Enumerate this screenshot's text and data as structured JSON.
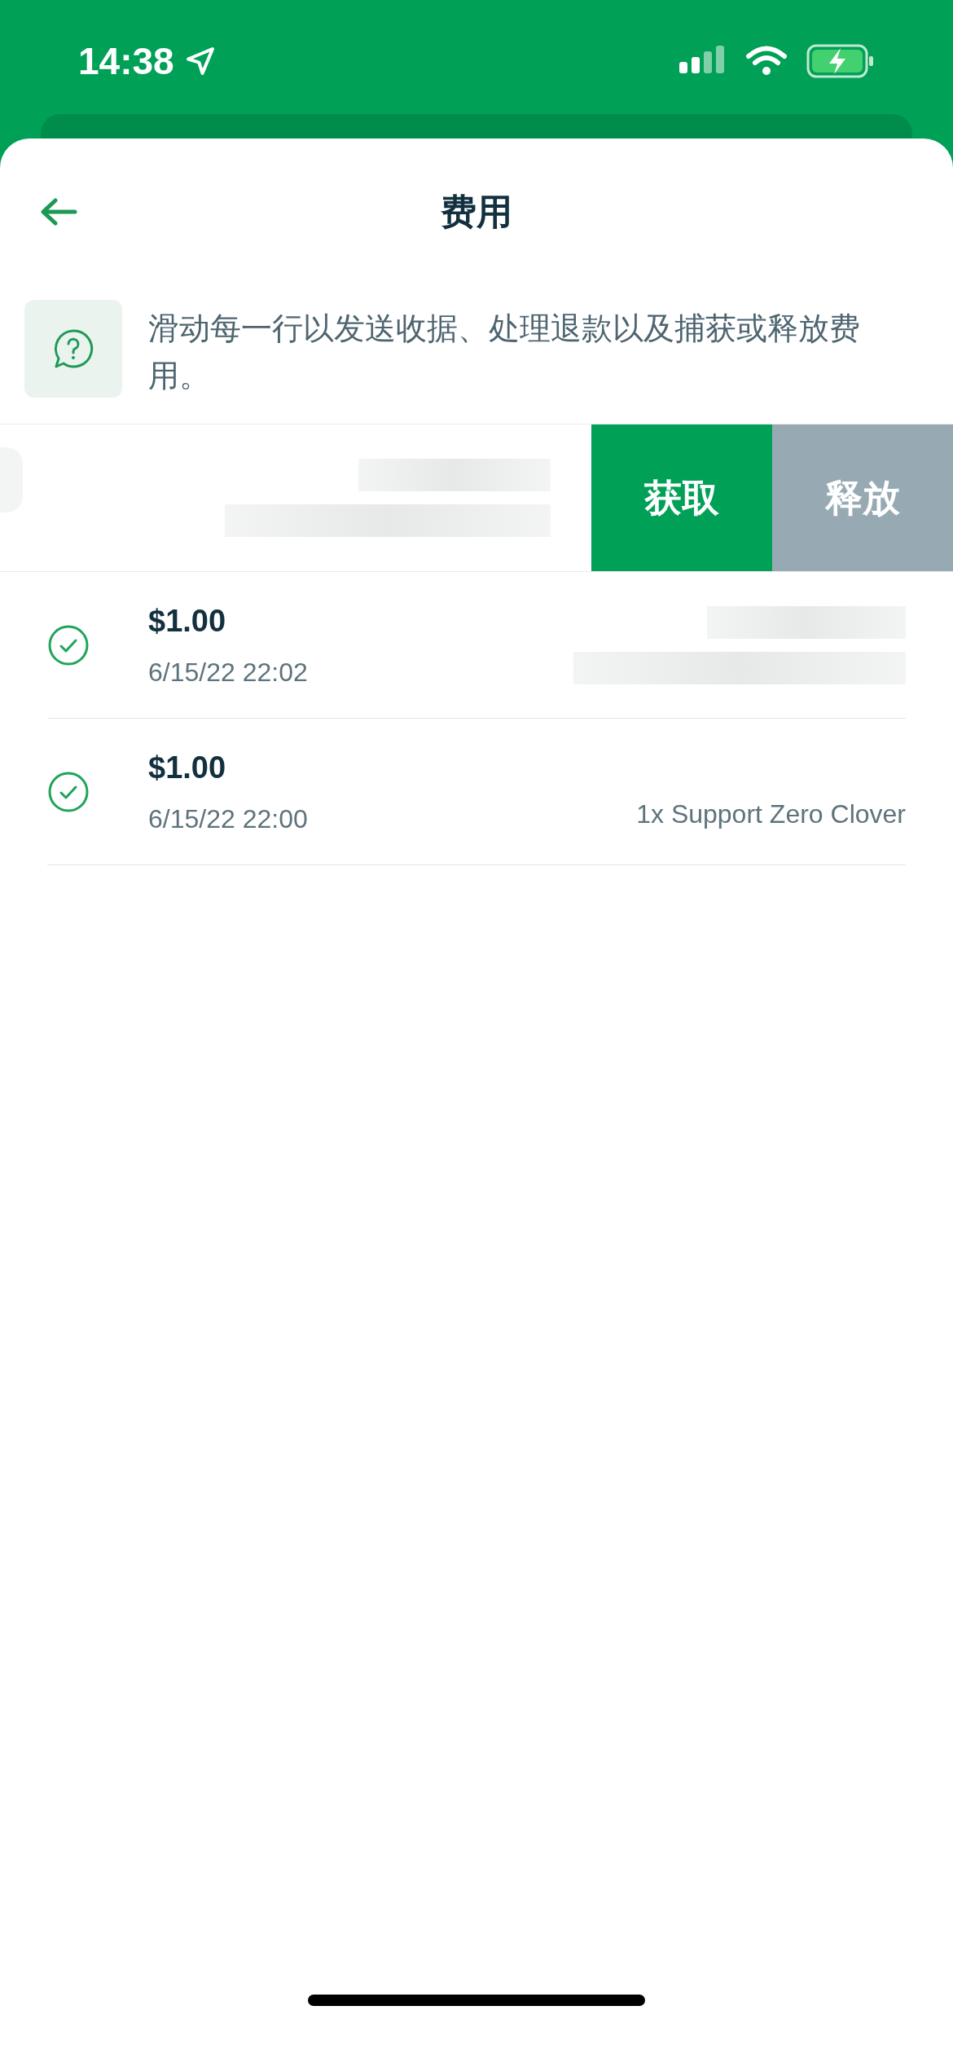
{
  "status_bar": {
    "time": "14:38"
  },
  "header": {
    "title": "费用"
  },
  "info": {
    "text": "滑动每一行以发送收据、处理退款以及捕获或释放费用。"
  },
  "swiped_row": {
    "actions": [
      {
        "label": "获取",
        "kind": "capture"
      },
      {
        "label": "释放",
        "kind": "release"
      }
    ]
  },
  "charges": [
    {
      "amount": "$1.00",
      "date": "6/15/22 22:02",
      "completed": true,
      "description_redacted": true
    },
    {
      "amount": "$1.00",
      "date": "6/15/22 22:00",
      "completed": true,
      "description": "1x Support Zero Clover"
    }
  ]
}
